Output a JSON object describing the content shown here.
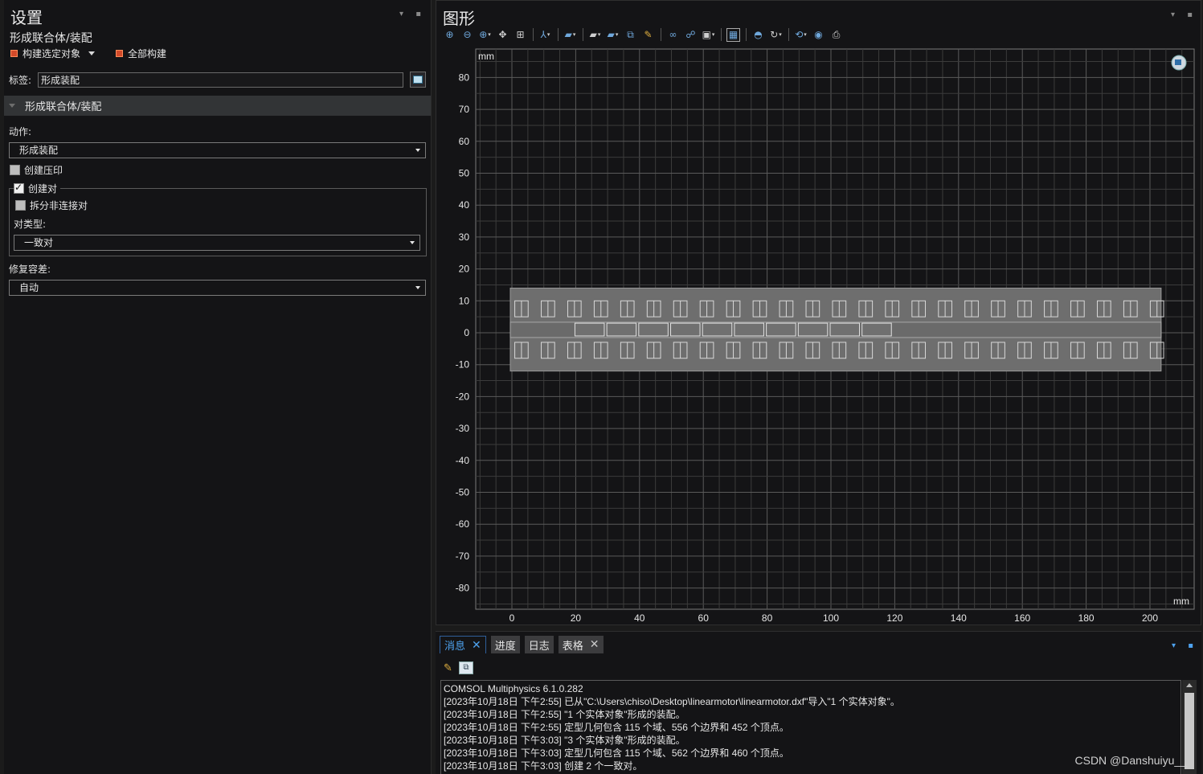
{
  "settings": {
    "title": "设置",
    "subtitle": "形成联合体/装配",
    "build_selected": "构建选定对象",
    "build_all": "全部构建",
    "label_caption": "标签:",
    "label_value": "形成装配",
    "section_title": "形成联合体/装配",
    "action_label": "动作:",
    "action_value": "形成装配",
    "create_imprint": "创建压印",
    "create_pairs": "创建对",
    "split_pairs": "拆分非连接对",
    "pair_type_label": "对类型:",
    "pair_type_value": "一致对",
    "repair_tol_label": "修复容差:",
    "repair_tol_value": "自动"
  },
  "graphics": {
    "title": "图形",
    "unit_top": "mm",
    "unit_bottom": "mm",
    "x_ticks": [
      "0",
      "20",
      "40",
      "60",
      "80",
      "100",
      "120",
      "140",
      "160",
      "180",
      "200"
    ],
    "y_ticks": [
      "80",
      "70",
      "60",
      "50",
      "40",
      "30",
      "20",
      "10",
      "0",
      "-10",
      "-20",
      "-30",
      "-40",
      "-50",
      "-60",
      "-70",
      "-80"
    ],
    "toolbar": [
      "zoom-in-icon",
      "zoom-out-icon",
      "zoom-box-icon",
      "pan-icon",
      "zoom-extents-icon",
      "axis-icon",
      "view-icon",
      "select-domain-icon",
      "select-boundary-icon",
      "select-object-icon",
      "clear-selection-icon",
      "hide-icon",
      "show-icon",
      "render-icon",
      "grid-icon",
      "scene-light-icon",
      "transparency-icon",
      "reset-view-icon",
      "snapshot-icon",
      "print-icon"
    ]
  },
  "messages": {
    "tabs": [
      "消息",
      "进度",
      "日志",
      "表格"
    ],
    "lines": [
      "COMSOL Multiphysics 6.1.0.282",
      "[2023年10月18日 下午2:55] 已从\"C:\\Users\\chiso\\Desktop\\linearmotor\\linearmotor.dxf\"导入\"1 个实体对象\"。",
      "[2023年10月18日 下午2:55] \"1 个实体对象\"形成的装配。",
      "[2023年10月18日 下午2:55] 定型几何包含 115 个域、556 个边界和 452 个顶点。",
      "[2023年10月18日 下午3:03] \"3 个实体对象\"形成的装配。",
      "[2023年10月18日 下午3:03] 定型几何包含 115 个域、562 个边界和 460 个顶点。",
      "[2023年10月18日 下午3:03] 创建 2 个一致对。"
    ]
  },
  "watermark": "CSDN @Danshuiyu__"
}
